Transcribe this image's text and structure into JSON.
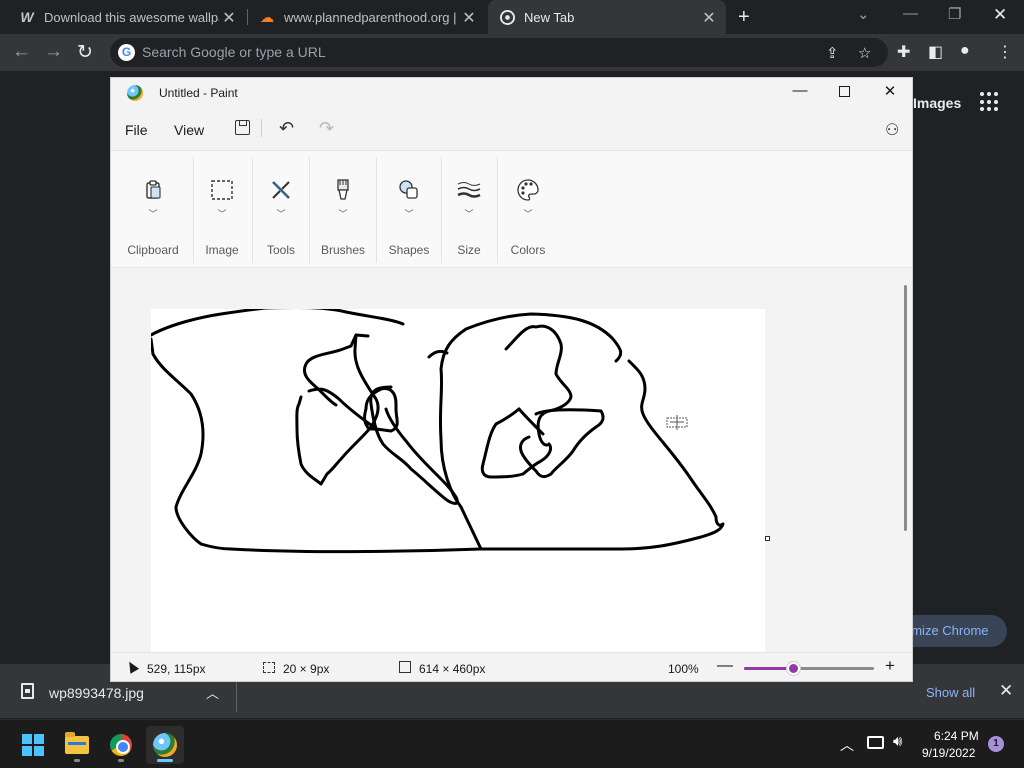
{
  "chrome": {
    "tabs": [
      {
        "title": "Download this awesome wallpap",
        "icon": "wallpaper-w-icon",
        "active": false
      },
      {
        "title": "www.plannedparenthood.org | Cl",
        "icon": "cloudflare-icon",
        "active": false
      },
      {
        "title": "New Tab",
        "icon": "chrome-icon",
        "active": true
      }
    ],
    "new_tab_symbol": "+",
    "omnibox_placeholder": "Search Google or type a URL",
    "newtab_page": {
      "images_link": "Images",
      "customize_label": "omize Chrome"
    },
    "download": {
      "filename": "wp8993478.jpg",
      "show_all": "Show all"
    }
  },
  "paint": {
    "window_title": "Untitled - Paint",
    "menu": {
      "file": "File",
      "view": "View"
    },
    "ribbon_groups": [
      {
        "label": "Clipboard",
        "icon": "clipboard-icon"
      },
      {
        "label": "Image",
        "icon": "selection-rectangle-icon"
      },
      {
        "label": "Tools",
        "icon": "pencil-ruler-icon"
      },
      {
        "label": "Brushes",
        "icon": "brush-icon"
      },
      {
        "label": "Shapes",
        "icon": "shapes-icon"
      },
      {
        "label": "Size",
        "icon": "line-size-icon"
      },
      {
        "label": "Colors",
        "icon": "palette-icon"
      }
    ],
    "status": {
      "cursor_position": "529, 115px",
      "selection_size": "20 × 9px",
      "canvas_size": "614 × 460px",
      "zoom": "100%",
      "zoom_fraction": 0.38
    },
    "accent_color": "#8e3ba8"
  },
  "taskbar": {
    "apps": [
      {
        "name": "start",
        "icon": "windows-start-icon"
      },
      {
        "name": "file-explorer",
        "icon": "folder-icon"
      },
      {
        "name": "chrome",
        "icon": "chrome-icon"
      },
      {
        "name": "paint",
        "icon": "paint-icon",
        "active": true
      }
    ],
    "time": "6:24 PM",
    "date": "9/19/2022",
    "notification_count": "1"
  }
}
